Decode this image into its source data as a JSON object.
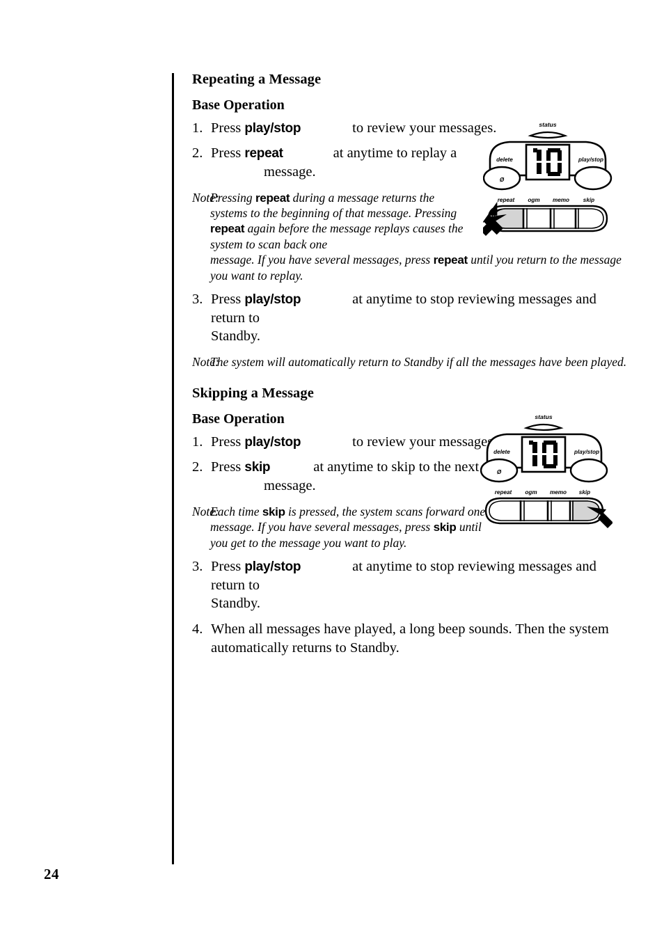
{
  "page": {
    "number": "24"
  },
  "sections": [
    {
      "title": "Repeating a Message",
      "subtitle": "Base Operation",
      "steps": [
        {
          "num": "1.",
          "press_label": "Press",
          "button": "play/stop",
          "rest": "to review your messages."
        },
        {
          "num": "2.",
          "press_label": "Press",
          "button": "repeat",
          "rest": "at anytime to replay a",
          "rest2": "message."
        },
        {
          "num": "3.",
          "press_label": "Press",
          "button": "play/stop",
          "rest": "at anytime to stop reviewing messages and return to",
          "rest2": "Standby."
        }
      ],
      "note1": {
        "label": "Note:",
        "p1": "Pressing ",
        "b1": "repeat",
        "p2": " during a message returns the systems to the beginning of that message. Pressing ",
        "b2": "repeat",
        "p3": " again before the message replays causes the system to scan back one ",
        "p4": "message. If you have several messages, press ",
        "b3": "repeat",
        "p5": " until you return to the message you want to replay."
      },
      "note2": {
        "label": "Note:",
        "text": "The system will automatically return to Standby if all the messages have been played."
      }
    },
    {
      "title": "Skipping a Message",
      "subtitle": "Base Operation",
      "steps": [
        {
          "num": "1.",
          "press_label": "Press",
          "button": "play/stop",
          "rest": "to review your messages."
        },
        {
          "num": "2.",
          "press_label": "Press",
          "button": "skip",
          "rest": "at anytime to skip to the next",
          "rest2": "message."
        },
        {
          "num": "3.",
          "press_label": "Press",
          "button": "play/stop",
          "rest": "at anytime to stop reviewing messages and return to",
          "rest2": "Standby."
        },
        {
          "num": "4.",
          "text": "When all messages have played, a long beep sounds. Then the system automatically returns to Standby."
        }
      ],
      "note1": {
        "label": "Note:",
        "p1": "Each time ",
        "b1": "skip",
        "p2": " is pressed, the system scans forward one message. If you have several messages, press ",
        "b2": "skip",
        "p3": " until you get to the message you want to play."
      }
    }
  ],
  "device": {
    "status_label": "status",
    "display_value": "10",
    "delete_label": "delete",
    "delete_symbol": "Ø",
    "playstop_label": "play/stop",
    "buttons": [
      "repeat",
      "ogm",
      "memo",
      "skip"
    ],
    "highlight_color": "#d4d4d4",
    "outline_color": "#000000",
    "highlighted_1": "repeat",
    "highlighted_2": "skip"
  }
}
